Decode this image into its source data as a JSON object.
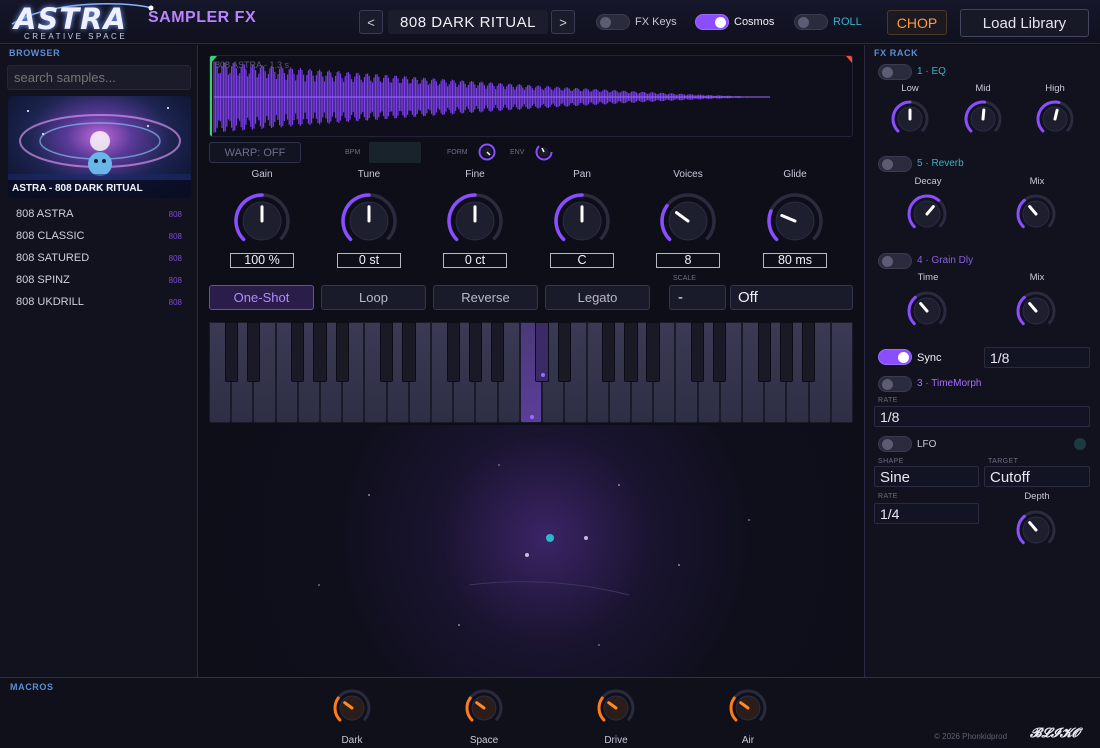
{
  "header": {
    "logo_text": "ASTRA",
    "logo_sub": "CREATIVE SPACE",
    "title": "SAMPLER FX",
    "prev_label": "<",
    "next_label": ">",
    "preset_name": "808 DARK RITUAL",
    "toggles": [
      {
        "label": "FX Keys",
        "on": false
      },
      {
        "label": "Cosmos",
        "on": true
      },
      {
        "label": "ROLL",
        "on": false
      }
    ],
    "chop_label": "CHOP",
    "load_label": "Load Library"
  },
  "browser": {
    "section_label": "BROWSER",
    "search_placeholder": "search samples...",
    "art_caption": "ASTRA - 808 DARK RITUAL",
    "items": [
      {
        "name": "808 ASTRA",
        "tag": "808"
      },
      {
        "name": "808 CLASSIC",
        "tag": "808"
      },
      {
        "name": "808 SATURED",
        "tag": "808"
      },
      {
        "name": "808 SPINZ",
        "tag": "808"
      },
      {
        "name": "808 UKDRILL",
        "tag": "808"
      }
    ]
  },
  "waveform": {
    "label": "808 ASTRA - 1.3 s",
    "warp_label": "WARP: OFF",
    "bpm_label": "BPM",
    "form_label": "FORM",
    "env_label": "ENV"
  },
  "knobs": [
    {
      "label": "Gain",
      "value": "100 %",
      "level": 0.5
    },
    {
      "label": "Tune",
      "value": "0 st",
      "level": 0.5
    },
    {
      "label": "Fine",
      "value": "0 ct",
      "level": 0.5
    },
    {
      "label": "Pan",
      "value": "C",
      "level": 0.5
    },
    {
      "label": "Voices",
      "value": "8",
      "level": 0.3
    },
    {
      "label": "Glide",
      "value": "80 ms",
      "level": 0.25
    }
  ],
  "modes": {
    "buttons": [
      "One-Shot",
      "Loop",
      "Reverse",
      "Legato"
    ],
    "active": "One-Shot",
    "scale_label": "SCALE",
    "scale_value": "-",
    "scale_mode": "Off"
  },
  "fx_rack": {
    "section_label": "FX RACK",
    "eq": {
      "name": "1 · EQ",
      "on": false,
      "knobs": [
        {
          "label": "Low",
          "level": 0.5
        },
        {
          "label": "Mid",
          "level": 0.52
        },
        {
          "label": "High",
          "level": 0.55
        }
      ]
    },
    "reverb": {
      "name": "5 · Reverb",
      "on": false,
      "knobs": [
        {
          "label": "Decay",
          "level": 0.65
        },
        {
          "label": "Mix",
          "level": 0.35
        }
      ]
    },
    "grain": {
      "name": "4 · Grain Dly",
      "on": false,
      "knobs": [
        {
          "label": "Time",
          "level": 0.35
        },
        {
          "label": "Mix",
          "level": 0.35
        }
      ]
    },
    "sync": {
      "label": "Sync",
      "on": true,
      "value": "1/8"
    },
    "timemorph": {
      "name": "3 · TimeMorph",
      "on": false,
      "rate_label": "RATE",
      "rate_value": "1/8"
    },
    "lfo": {
      "name": "LFO",
      "on": false,
      "shape_label": "SHAPE",
      "shape_value": "Sine",
      "target_label": "TARGET",
      "target_value": "Cutoff",
      "rate_label": "RATE",
      "rate_value": "1/4",
      "depth_label": "Depth",
      "depth_level": 0.35
    }
  },
  "macros": {
    "section_label": "MACROS",
    "knobs": [
      {
        "label": "Dark",
        "level": 0.3
      },
      {
        "label": "Space",
        "level": 0.3
      },
      {
        "label": "Drive",
        "level": 0.3
      },
      {
        "label": "Air",
        "level": 0.3
      }
    ],
    "copyright": "© 2026 Phonkidprod",
    "signature": "BLIKO"
  },
  "colors": {
    "accent": "#8a4dff",
    "accent_light": "#b884ff",
    "orange": "#ff9a3c",
    "teal": "#2fb6c8"
  }
}
